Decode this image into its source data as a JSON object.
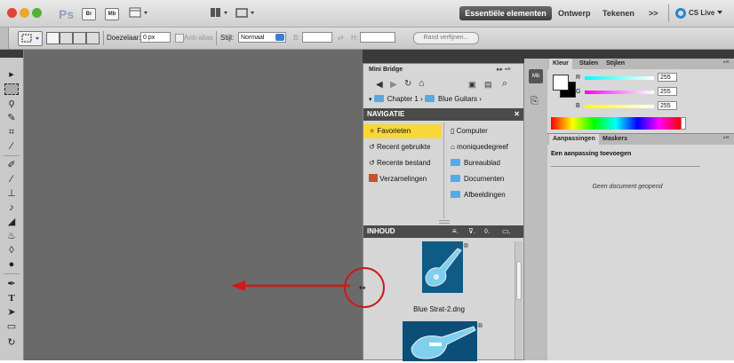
{
  "appbar": {
    "ps_logo": "Ps",
    "br_icon": "Br",
    "mb_icon": "Mb",
    "workspaces": [
      "Essentiële elementen",
      "Ontwerp",
      "Tekenen"
    ],
    "more": ">>",
    "cslive": "CS Live"
  },
  "options": {
    "feather_label": "Doezelaar:",
    "feather_value": "0 px",
    "antialias": "Anti-alias",
    "style_label": "Stijl:",
    "style_value": "Normaal",
    "width_label": "B:",
    "height_label": "H:",
    "refine_button": "Rand verfijnen..."
  },
  "minibridge": {
    "tab": "Mini Bridge",
    "breadcrumb_1": "Chapter 1",
    "breadcrumb_2": "Blue Guitars",
    "nav_header": "NAVIGATIE",
    "left_items": [
      "Favorieten",
      "Recent gebruikte",
      "Recente bestand",
      "Verzamelingen"
    ],
    "right_items": [
      "Computer",
      "moniquedegreef",
      "Bureaublad",
      "Documenten",
      "Afbeeldingen"
    ],
    "content_header": "INHOUD",
    "file_1": "Blue Strat-2.dng"
  },
  "color_panel": {
    "tabs": [
      "Kleur",
      "Stalen",
      "Stijlen"
    ],
    "r_label": "R",
    "g_label": "G",
    "b_label": "B",
    "r_value": "255",
    "g_value": "255",
    "b_value": "255"
  },
  "adjust_panel": {
    "tabs": [
      "Aanpassingen",
      "Maskers"
    ],
    "title": "Een aanpassing toevoegen",
    "message": "Geen document geopend"
  },
  "colors": {
    "annotation": "#cc1a1a",
    "favorite_highlight": "#f7d73a",
    "canvas": "#6a6a6a"
  }
}
